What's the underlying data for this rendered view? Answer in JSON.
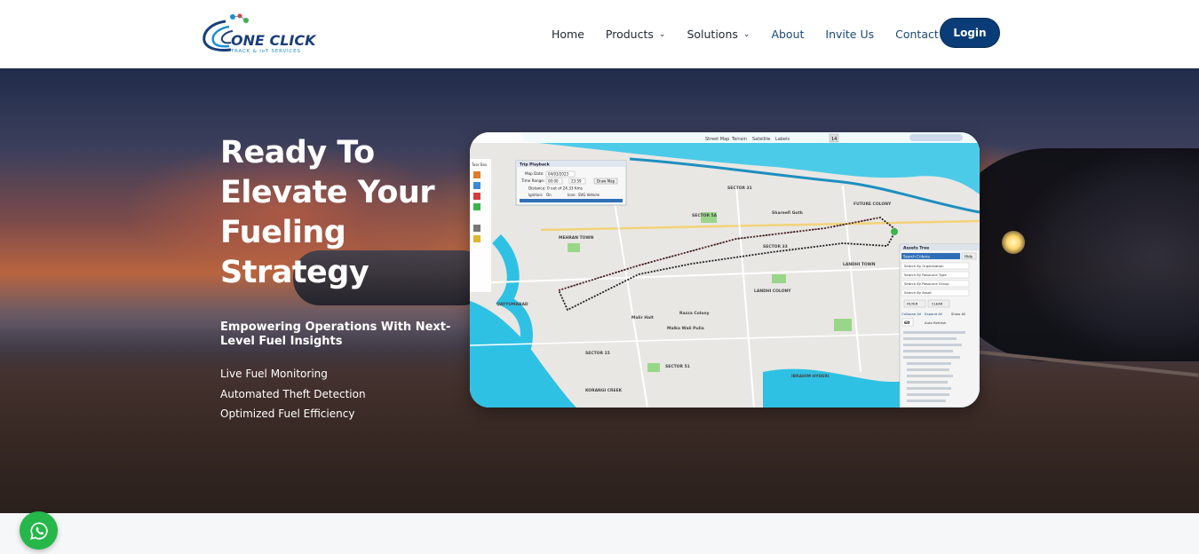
{
  "brand": {
    "name": "ONE CLICK",
    "tagline": "TRACK & IoT SERVICES",
    "colors": {
      "primary": "#0a3d77",
      "accent": "#1a8fd6",
      "green": "#3ab54a",
      "red": "#e03a3a"
    }
  },
  "nav": {
    "items": [
      {
        "label": "Home",
        "has_dropdown": false
      },
      {
        "label": "Products",
        "has_dropdown": true
      },
      {
        "label": "Solutions",
        "has_dropdown": true
      },
      {
        "label": "About",
        "has_dropdown": false
      },
      {
        "label": "Invite Us",
        "has_dropdown": false
      },
      {
        "label": "Contact",
        "has_dropdown": false
      }
    ],
    "login_label": "Login"
  },
  "hero": {
    "title_lines": [
      "Ready To",
      "Elevate Your",
      "Fueling",
      "Strategy"
    ],
    "subtitle": "Empowering Operations With Next-Level Fuel Insights",
    "features": [
      "Live Fuel Monitoring",
      "Automated Theft Detection",
      "Optimized Fuel Efficiency"
    ]
  },
  "map_preview": {
    "toolbar_labels": [
      "Street Map",
      "Terrain",
      "Satellite",
      "Labels"
    ],
    "zoom": "14",
    "playback_title": "Trip Playback",
    "map_date_label": "Map Date:",
    "map_date": "04/03/2023",
    "time_range_label": "Time Range:",
    "time_from": "00:00",
    "time_to": "23:59",
    "draw_map_label": "Draw Map",
    "distance_text": "Distance: 0 out of 24.33 Kms",
    "ignition_label": "Ignition:",
    "ignition_value": "On",
    "icon_label": "Icon:",
    "icon_value": "SVG Vehicle",
    "task_box_label": "Task Box",
    "assets_tree_title": "Assets Tree",
    "search_criteria_label": "Search Criteria",
    "hide_label": "Hide",
    "search_options": [
      "Search By Organization",
      "Search By Resource Type",
      "Search By Resource Group",
      "Search By Asset"
    ],
    "filter_label": "FILTER",
    "clear_label": "CLEAR",
    "collapse_label": "Collapse All",
    "expand_label": "Expand All",
    "show_all_label": "Show All",
    "refresh_value": "60",
    "auto_refresh_label": "Auto Refresh",
    "place_labels": [
      "MEHRAN TOWN",
      "SECTOR 5A",
      "SECTOR 31",
      "LANDHI TOWN",
      "LANDHI COLONY",
      "SECTOR 33",
      "KORANGI CREEK",
      "QAYYUMABAD",
      "SECTOR 51",
      "FUTURE COLONY",
      "Malir Halt",
      "Shareefi Goth",
      "IBRAHIM HYDERI",
      "Razza Colony",
      "Malka Wali Pulia",
      "SECTOR 15"
    ]
  },
  "whatsapp": {
    "icon": "whatsapp-icon"
  }
}
